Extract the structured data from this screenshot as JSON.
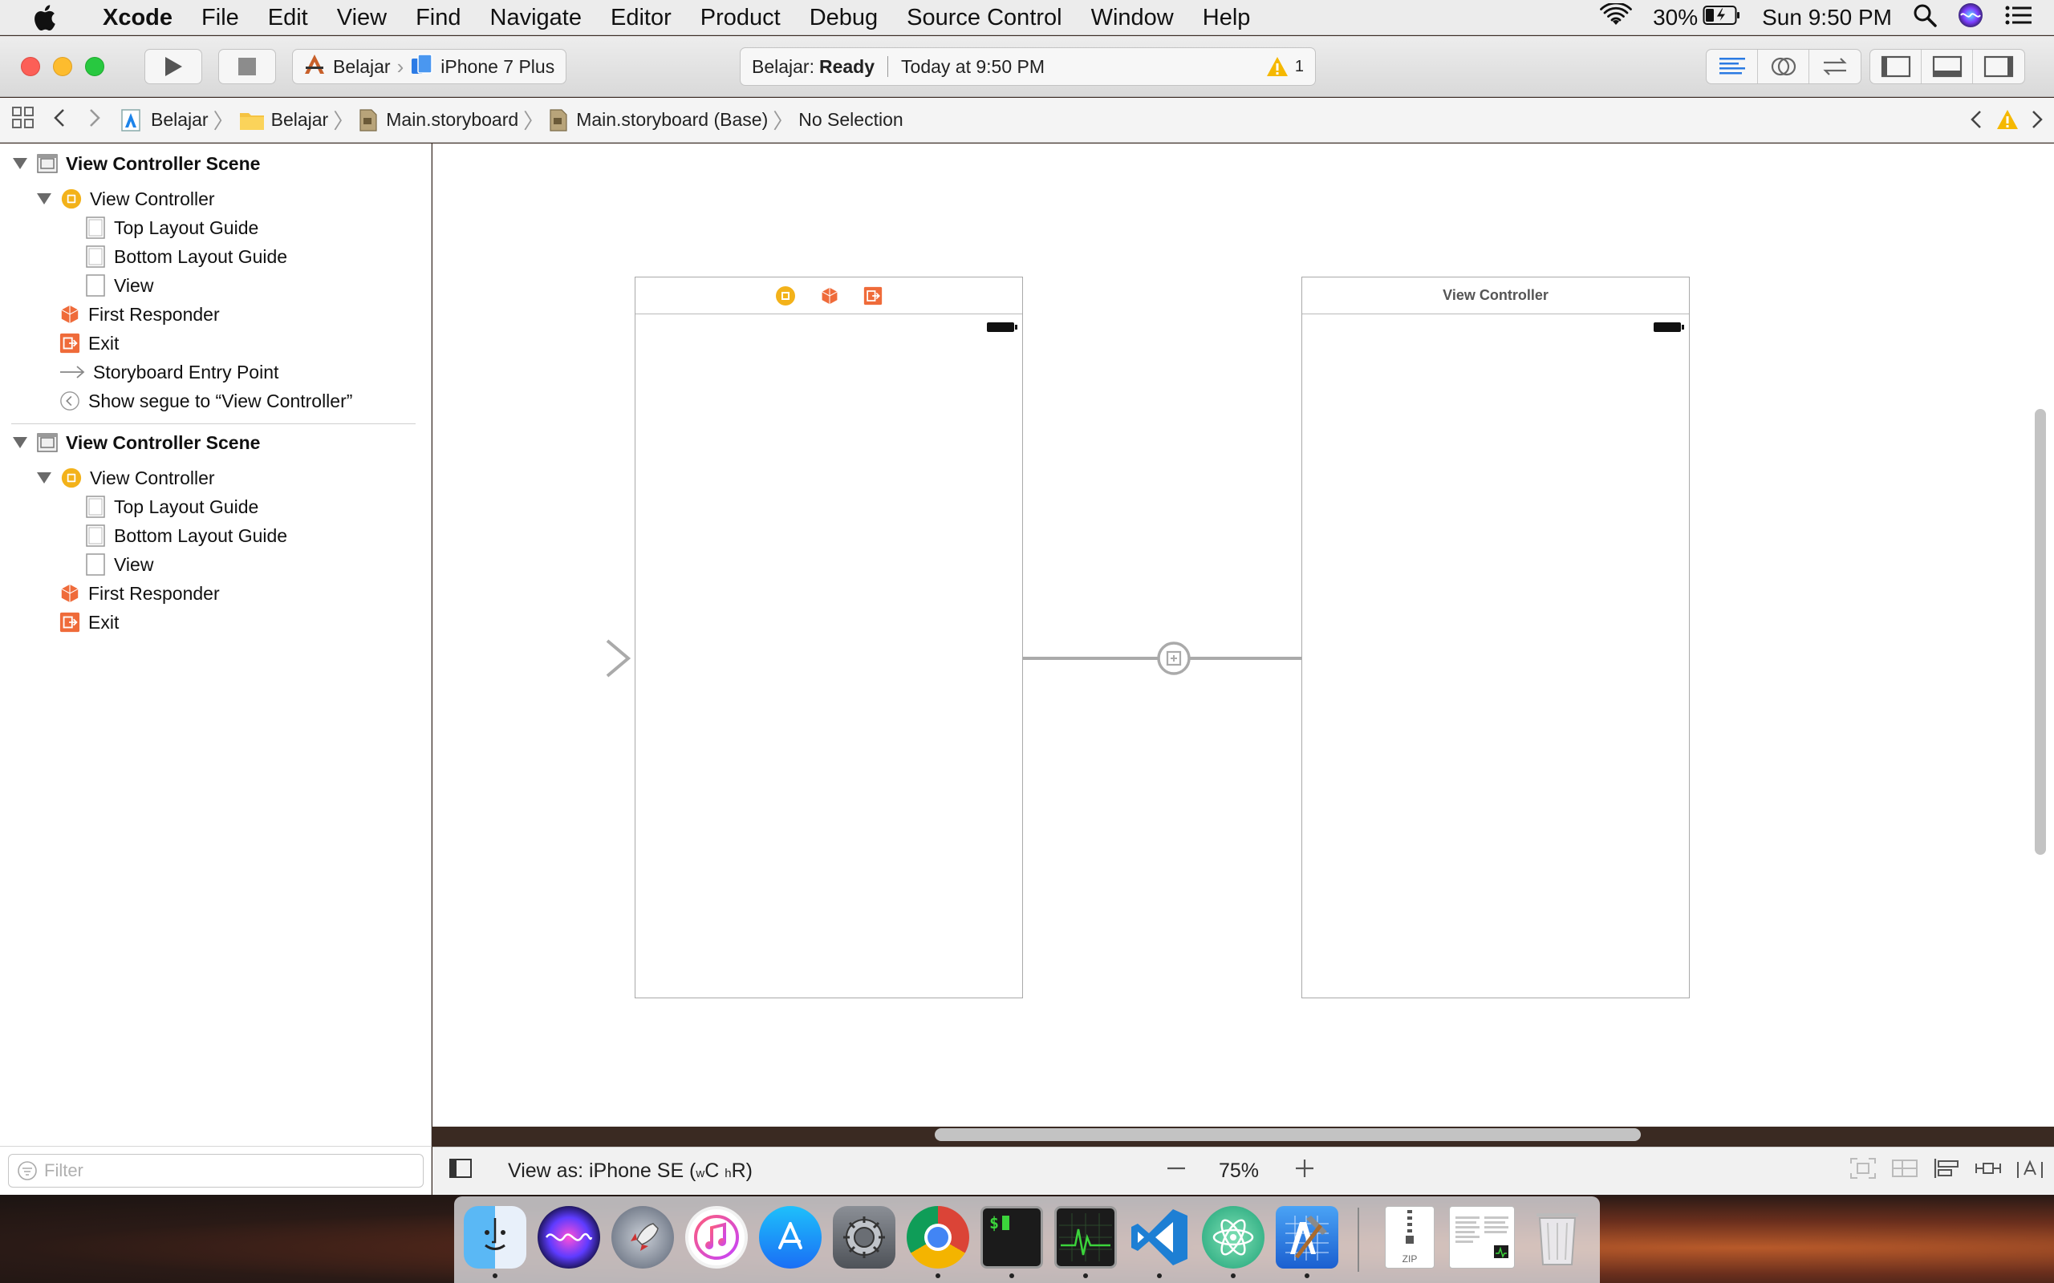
{
  "menubar": {
    "app_name": "Xcode",
    "items": [
      "File",
      "Edit",
      "View",
      "Find",
      "Navigate",
      "Editor",
      "Product",
      "Debug",
      "Source Control",
      "Window",
      "Help"
    ],
    "battery": "30%",
    "clock": "Sun 9:50 PM"
  },
  "toolbar": {
    "scheme": "Belajar",
    "device": "iPhone 7 Plus",
    "status_project": "Belajar:",
    "status_state": "Ready",
    "status_time": "Today at 9:50 PM",
    "warning_count": "1"
  },
  "jumpbar": {
    "crumbs": [
      "Belajar",
      "Belajar",
      "Main.storyboard",
      "Main.storyboard (Base)",
      "No Selection"
    ]
  },
  "navigator": {
    "scene1": {
      "title": "View Controller Scene",
      "controller": "View Controller",
      "top_guide": "Top Layout Guide",
      "bottom_guide": "Bottom Layout Guide",
      "view": "View",
      "first_responder": "First Responder",
      "exit": "Exit",
      "entry_point": "Storyboard Entry Point",
      "segue": "Show segue to “View Controller”"
    },
    "scene2": {
      "title": "View Controller Scene",
      "controller": "View Controller",
      "top_guide": "Top Layout Guide",
      "bottom_guide": "Bottom Layout Guide",
      "view": "View",
      "first_responder": "First Responder",
      "exit": "Exit"
    },
    "filter_placeholder": "Filter"
  },
  "canvas": {
    "scene2_title": "View Controller"
  },
  "bottombar": {
    "view_as": "View as: iPhone SE (",
    "size_w": "w",
    "size_c": "C ",
    "size_h": "h",
    "size_r": "R)",
    "zoom": "75%"
  },
  "dock": {
    "apps": [
      "finder-icon",
      "siri-icon",
      "launchpad-icon",
      "itunes-icon",
      "app-store-icon",
      "system-preferences-icon",
      "chrome-icon",
      "terminal-icon",
      "activity-monitor-icon",
      "vscode-icon",
      "atom-icon",
      "xcode-icon",
      "archive-icon",
      "document-icon",
      "trash-icon"
    ],
    "terminal_prompt": "$",
    "archive_label": "ZIP"
  }
}
